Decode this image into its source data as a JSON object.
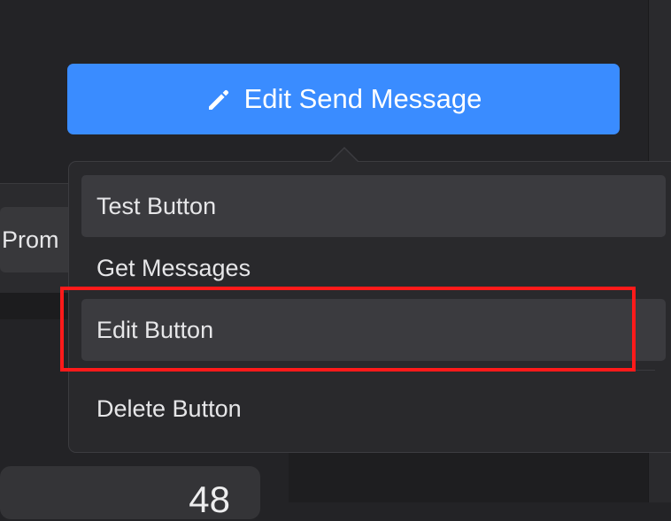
{
  "colors": {
    "background": "#232326",
    "primary_button": "#3a8cff",
    "menu_background": "#29292c",
    "menu_highlight": "#3b3b3f",
    "annotation": "#ff1a1a"
  },
  "background": {
    "prom_label": "Prom",
    "card_number": "48"
  },
  "edit_button": {
    "icon": "pencil-icon",
    "label": "Edit Send Message"
  },
  "menu": {
    "items": [
      {
        "label": "Test Button",
        "highlighted": true
      },
      {
        "label": "Get Messages",
        "highlighted": false
      },
      {
        "label": "Edit Button",
        "highlighted": true,
        "annotated": true
      },
      {
        "label": "Delete Button",
        "highlighted": false
      }
    ]
  }
}
